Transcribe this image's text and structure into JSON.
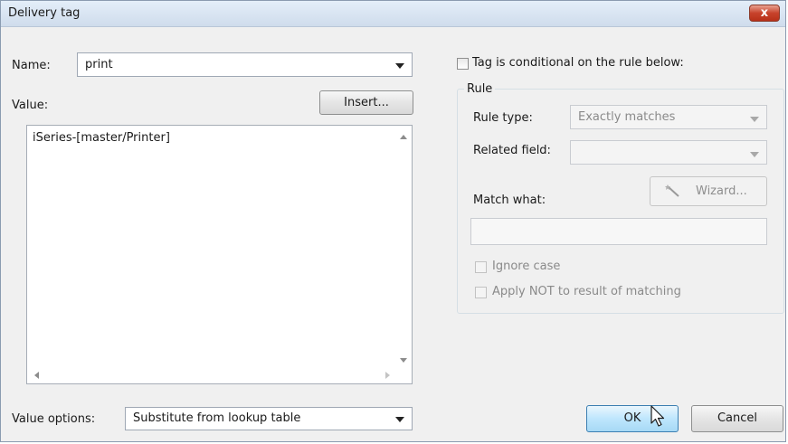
{
  "window": {
    "title": "Delivery tag",
    "close_glyph": "x"
  },
  "name_field": {
    "label": "Name:",
    "value": "print"
  },
  "value_field": {
    "label": "Value:",
    "insert_button": "Insert...",
    "content": "iSeries-[master/Printer]"
  },
  "value_options": {
    "label": "Value options:",
    "selected": "Substitute from lookup table"
  },
  "conditional": {
    "label": "Tag is conditional on the rule below:",
    "checked": false
  },
  "rule": {
    "legend": "Rule",
    "rule_type_label": "Rule type:",
    "rule_type_value": "Exactly matches",
    "related_field_label": "Related field:",
    "related_field_value": "",
    "match_what_label": "Match what:",
    "wizard_button": "Wizard...",
    "match_value": "",
    "ignore_case_label": "Ignore case",
    "apply_not_label": "Apply NOT to result of matching"
  },
  "buttons": {
    "ok": "OK",
    "cancel": "Cancel"
  },
  "icons": {
    "close": "close-icon",
    "wizard": "wand-icon",
    "cursor": "mouse-pointer-icon"
  },
  "colors": {
    "titlebar": "#cfdcec",
    "close": "#c7422b",
    "ok_button": "#bee6fd"
  }
}
